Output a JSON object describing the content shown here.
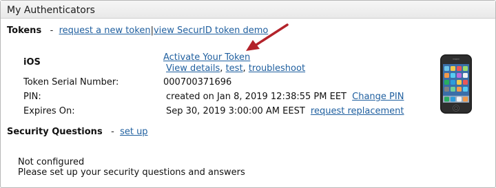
{
  "panel": {
    "title": "My Authenticators"
  },
  "tokens": {
    "heading": "Tokens",
    "dash": "-",
    "request_new": "request a new token",
    "pipe": "|",
    "view_demo": "view SecurID token demo"
  },
  "ios": {
    "label": "iOS",
    "activate": "Activate Your Token",
    "view_details": "View details",
    "comma1": ",",
    "test": "test",
    "comma2": ",",
    "troubleshoot": "troubleshoot"
  },
  "details": {
    "serial_label": "Token Serial Number:",
    "serial_value": "000700371696",
    "pin_label": "PIN:",
    "pin_value": "created on Jan 8, 2019 12:38:55 PM EET",
    "change_pin": "Change PIN",
    "expires_label": "Expires On:",
    "expires_value": "Sep 30, 2019 3:00:00 AM EEST",
    "request_replacement": "request replacement"
  },
  "security": {
    "heading": "Security Questions",
    "dash": "-",
    "set_up": "set up",
    "status": "Not configured",
    "message": "Please set up your security questions and answers"
  },
  "colors": {
    "link": "#1f5f9f",
    "arrow": "#b3232b"
  },
  "icons": {
    "phone": "smartphone-icon",
    "arrow": "annotation-arrow"
  }
}
